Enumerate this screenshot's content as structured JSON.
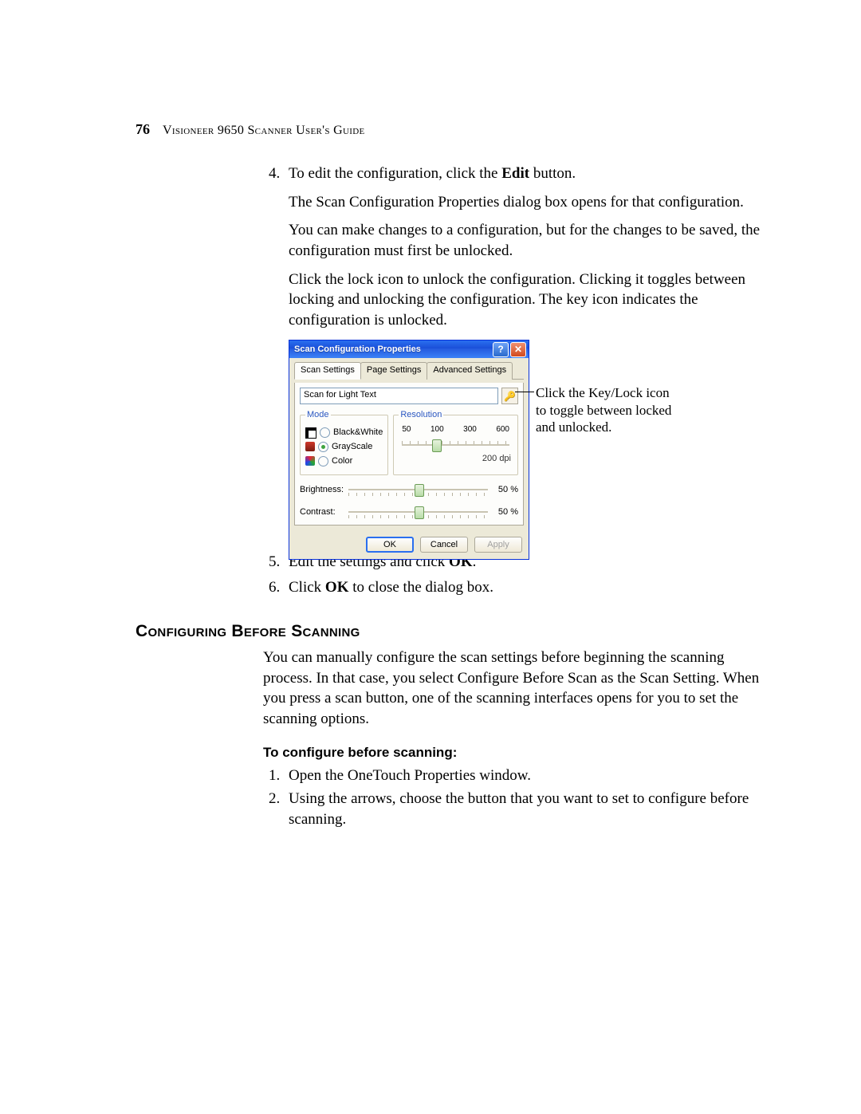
{
  "header": {
    "page_number": "76",
    "book_title": "Visioneer 9650 Scanner User's Guide"
  },
  "steps_top": {
    "start": 4,
    "items": [
      {
        "lead_a": "To edit the configuration, click the ",
        "lead_b_bold": "Edit",
        "lead_c": " button.",
        "p2": "The Scan Configuration Properties dialog box opens for that configuration.",
        "p3": "You can make changes to a configuration, but for the changes to be saved, the configuration must first be unlocked.",
        "p4": "Click the lock icon to unlock the configuration. Clicking it toggles between locking and unlocking the configuration. The key icon indicates the configuration is unlocked."
      }
    ]
  },
  "dialog": {
    "title": "Scan Configuration Properties",
    "help_glyph": "?",
    "close_glyph": "✕",
    "tabs": [
      "Scan Settings",
      "Page Settings",
      "Advanced Settings"
    ],
    "config_name": "Scan for Light Text",
    "lock_glyph": "🔑",
    "mode_legend": "Mode",
    "modes": [
      {
        "label": "Black&White",
        "checked": false,
        "icon": "bw"
      },
      {
        "label": "GrayScale",
        "checked": true,
        "icon": "gs"
      },
      {
        "label": "Color",
        "checked": false,
        "icon": "col"
      }
    ],
    "res_legend": "Resolution",
    "res_ticks": [
      "50",
      "100",
      "300",
      "600"
    ],
    "res_value_label": "200 dpi",
    "brightness_label": "Brightness:",
    "brightness_value": "50 %",
    "contrast_label": "Contrast:",
    "contrast_value": "50 %",
    "buttons": {
      "ok": "OK",
      "cancel": "Cancel",
      "apply": "Apply"
    }
  },
  "callout": "Click the Key/Lock icon to toggle between locked and unlocked.",
  "steps_bottom": [
    {
      "a": "Edit the settings and click ",
      "b_bold": "OK",
      "c": "."
    },
    {
      "a": "Click ",
      "b_bold": "OK",
      "c": " to close the dialog box."
    }
  ],
  "section_heading": "Configuring Before Scanning",
  "section_body": "You can manually configure the scan settings before beginning the scanning process. In that case, you select Configure Before Scan as the Scan Setting. When you press a scan button, one of the scanning interfaces opens for you to set the scanning options.",
  "sub_heading": "To configure before scanning:",
  "steps_configure": [
    "Open the OneTouch Properties window.",
    "Using the arrows, choose the button that you want to set to configure before scanning."
  ]
}
